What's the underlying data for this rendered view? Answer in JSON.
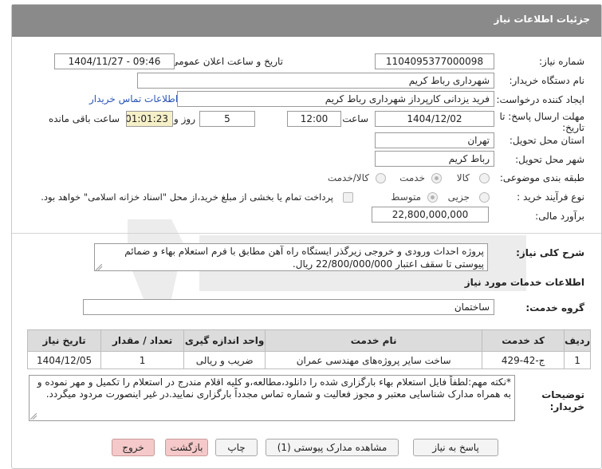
{
  "header": {
    "title": "جزئیات اطلاعات نیاز"
  },
  "fields": {
    "need_number_label": "شماره نیاز:",
    "need_number": "1104095377000098",
    "announce_label": "تاریخ و ساعت اعلان عمومی:",
    "announce_value": "1404/11/27 - 09:46",
    "buyer_label": "نام دستگاه خریدار:",
    "buyer_value": "شهرداری رباط کریم",
    "creator_label": "ایجاد کننده درخواست:",
    "creator_value": "فرید یزدانی کارپرداز شهرداری رباط کریم",
    "contact_link": "اطلاعات تماس خریدار",
    "deadline_label_1": "مهلت ارسال پاسخ: تا",
    "deadline_label_2": "تاریخ:",
    "deadline_date": "1404/12/02",
    "time_label": "ساعت",
    "deadline_time": "12:00",
    "days_value": "5",
    "days_label": "روز و",
    "remaining_value": "01:01:23",
    "remaining_label": "ساعت باقی مانده",
    "province_label": "استان محل تحویل:",
    "province_value": "تهران",
    "city_label": "شهر محل تحویل:",
    "city_value": "رباط کریم",
    "category_label": "طبقه بندی موضوعی:",
    "category_options": [
      "کالا",
      "خدمت",
      "کالا/خدمت"
    ],
    "purchase_label": "نوع فرآیند خرید :",
    "purchase_options": [
      "جزیی",
      "متوسط"
    ],
    "payment_note": "پرداخت تمام یا بخشی از مبلغ خرید،از محل \"اسناد خزانه اسلامی\" خواهد بود.",
    "budget_label": "برآورد مالی:",
    "budget_value": "22,800,000,000"
  },
  "description": {
    "label": "شرح کلی نیاز:",
    "text": "پروژه احداث ورودی و خروجی زیرگذر ایستگاه راه آهن مطابق با فرم استعلام بهاء و ضمائم پیوستی تا سقف اعتبار 22/800/000/000 ریال."
  },
  "services": {
    "section_title": "اطلاعات خدمات مورد نیاز",
    "group_label": "گروه خدمت:",
    "group_value": "ساختمان",
    "columns": [
      "ردیف",
      "کد خدمت",
      "نام خدمت",
      "واحد اندازه گیری",
      "تعداد / مقدار",
      "تاریخ نیاز"
    ],
    "rows": [
      [
        "1",
        "ج-42-429",
        "ساخت سایر پروژه‌های مهندسی عمران",
        "ضریب و ریالی",
        "1",
        "1404/12/05"
      ]
    ]
  },
  "notes": {
    "label_1": "توضیحات",
    "label_2": "خریدار:",
    "text": "*نکته مهم:لطفاً فایل استعلام بهاء بارگزاری شده را دانلود،مطالعه،و کلیه اقلام مندرج در استعلام را تکمیل و مهر نموده و به همراه مدارک شناسایی معتبر و مجوز فعالیت و شماره تماس مجدداً بارگزاری نمایید.در غیر اینصورت مردود میگردد."
  },
  "buttons": {
    "reply": "پاسخ به نیاز",
    "docs": "مشاهده مدارک پیوستی (1)",
    "print": "چاپ",
    "back": "بازگشت",
    "exit": "خروج"
  }
}
